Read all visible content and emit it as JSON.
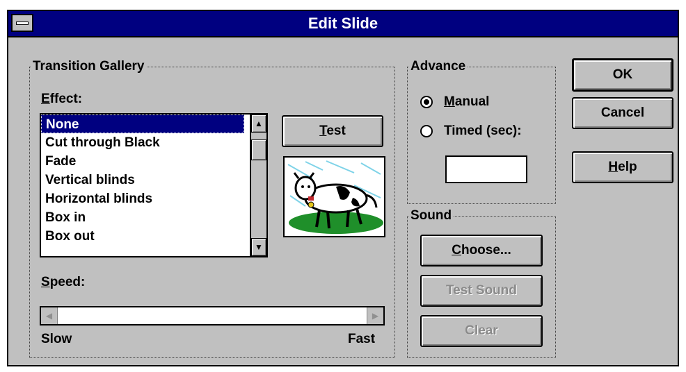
{
  "window": {
    "title": "Edit Slide"
  },
  "transition_gallery": {
    "legend": "Transition Gallery",
    "effect_label": "Effect:",
    "effects": [
      "None",
      "Cut through Black",
      "Fade",
      "Vertical blinds",
      "Horizontal blinds",
      "Box in",
      "Box out"
    ],
    "selected_effect": "None",
    "test_button": "Test",
    "speed_label": "Speed:",
    "speed_min_label": "Slow",
    "speed_max_label": "Fast",
    "preview_image": "cow-clipart"
  },
  "advance": {
    "legend": "Advance",
    "manual_label": "Manual",
    "timed_label": "Timed (sec):",
    "selected": "manual",
    "timed_value": ""
  },
  "sound": {
    "legend": "Sound",
    "choose_button": "Choose...",
    "test_sound_button": "Test Sound",
    "clear_button": "Clear"
  },
  "buttons": {
    "ok": "OK",
    "cancel": "Cancel",
    "help": "Help"
  },
  "icons": {
    "system_menu": "system-menu-icon",
    "scroll_up": "arrow-up-icon",
    "scroll_down": "arrow-down-icon",
    "scroll_left": "arrow-left-icon",
    "scroll_right": "arrow-right-icon"
  },
  "colors": {
    "titlebar": "#000080",
    "dialog_face": "#c0c0c0",
    "selection": "#000080"
  }
}
